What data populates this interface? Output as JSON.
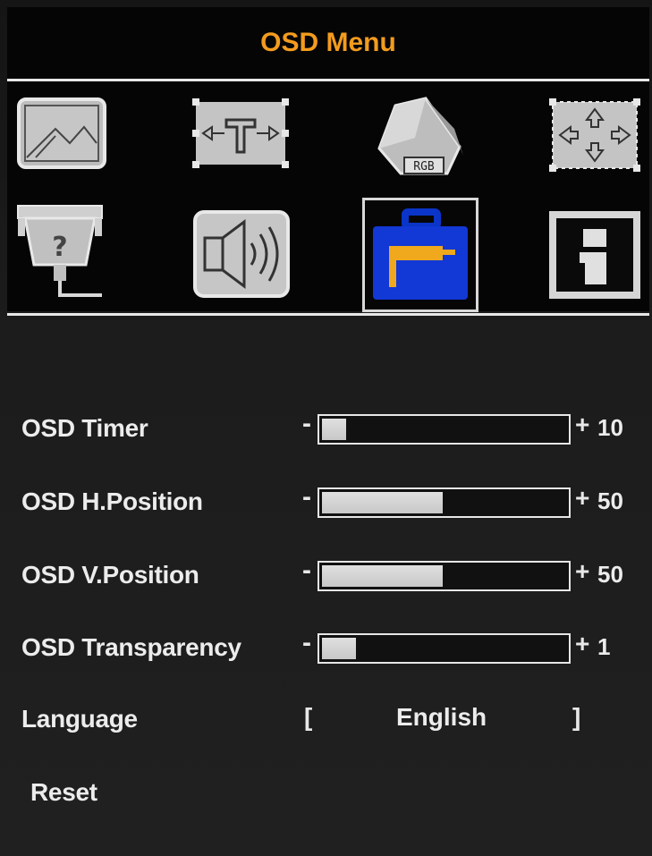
{
  "osd": {
    "title": "OSD Menu",
    "accent_color": "#f39b1e",
    "icons": [
      {
        "name": "picture-icon",
        "selected": false
      },
      {
        "name": "geometry-icon",
        "selected": false
      },
      {
        "name": "color-rgb-icon",
        "selected": false,
        "text": "RGB"
      },
      {
        "name": "position-icon",
        "selected": false
      },
      {
        "name": "input-source-icon",
        "selected": false
      },
      {
        "name": "audio-icon",
        "selected": false
      },
      {
        "name": "osd-setup-toolbox-icon",
        "selected": true
      },
      {
        "name": "information-icon",
        "selected": false
      }
    ],
    "settings": [
      {
        "label": "OSD Timer",
        "minus": "-",
        "plus": "+",
        "value": "10",
        "level_percent": 10
      },
      {
        "label": "OSD H.Position",
        "minus": "-",
        "plus": "+",
        "value": "50",
        "level_percent": 50
      },
      {
        "label": "OSD V.Position",
        "minus": "-",
        "plus": "+",
        "value": "50",
        "level_percent": 50
      },
      {
        "label": "OSD Transparency",
        "minus": "-",
        "plus": "+",
        "value": "1",
        "level_percent": 14
      }
    ],
    "language": {
      "label": "Language",
      "open_bracket": "[",
      "value": "English",
      "close_bracket": "]"
    },
    "reset": {
      "label": "Reset"
    }
  }
}
